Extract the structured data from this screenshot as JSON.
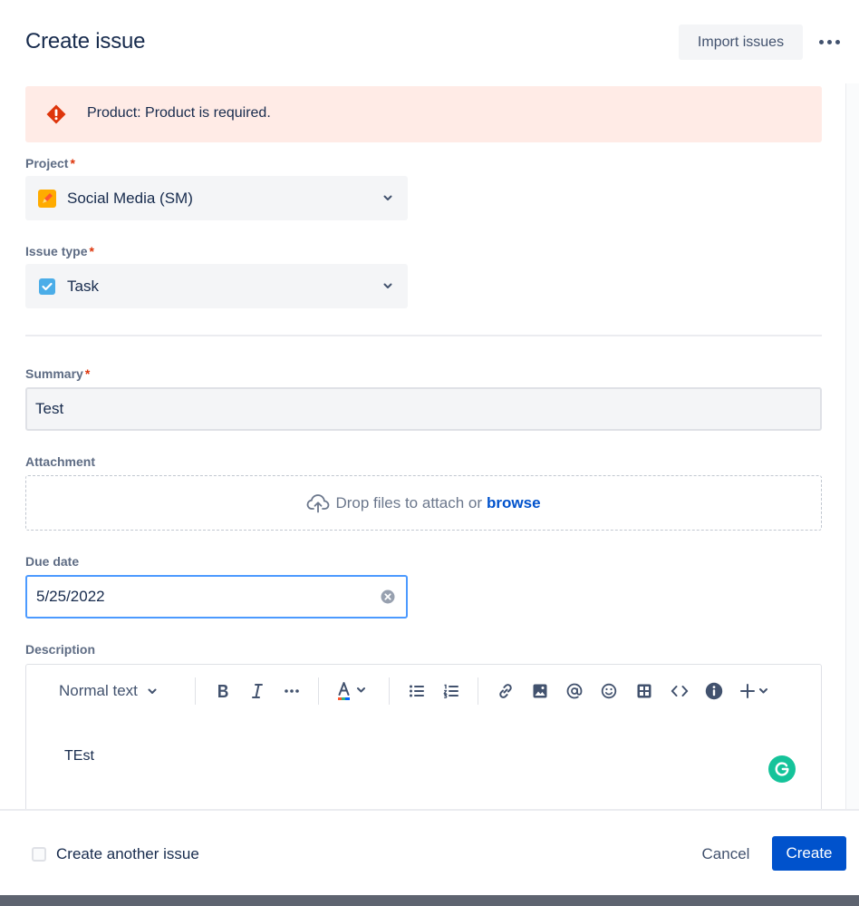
{
  "dialog": {
    "title": "Create issue",
    "import_label": "Import issues"
  },
  "error": {
    "message": "Product: Product is required.",
    "color": "#de350b"
  },
  "fields": {
    "project": {
      "label": "Project",
      "required": "*",
      "value": "Social Media (SM)"
    },
    "issue_type": {
      "label": "Issue type",
      "required": "*",
      "value": "Task"
    },
    "summary": {
      "label": "Summary",
      "required": "*",
      "value": "Test"
    },
    "attachment": {
      "label": "Attachment",
      "drop_text": "Drop files to attach or",
      "browse_label": "browse"
    },
    "due_date": {
      "label": "Due date",
      "value": "5/25/2022"
    },
    "description": {
      "label": "Description",
      "text_style": "Normal text",
      "content": "TEst"
    }
  },
  "toolbar_icons": [
    "bold-icon",
    "italic-icon",
    "more-formatting-icon",
    "text-color-icon",
    "bullet-list-icon",
    "numbered-list-icon",
    "link-icon",
    "image-icon",
    "mention-icon",
    "emoji-icon",
    "table-icon",
    "code-icon",
    "info-panel-icon",
    "insert-icon"
  ],
  "footer": {
    "create_another_label": "Create another issue",
    "cancel_label": "Cancel",
    "create_label": "Create"
  },
  "colors": {
    "primary": "#0052cc",
    "error_bg": "#ffebe6",
    "focus": "#4c9aff",
    "grammarly": "#15c39a"
  }
}
